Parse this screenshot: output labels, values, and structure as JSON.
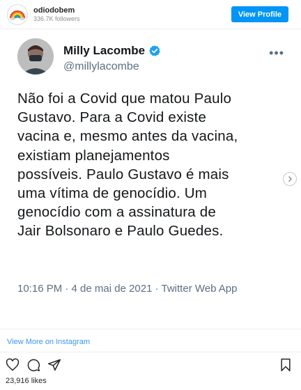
{
  "instagram": {
    "username": "odiodobem",
    "followers": "336.7K followers",
    "view_profile_label": "View Profile",
    "view_more_label": "View More on Instagram",
    "likes": "23,916 likes"
  },
  "tweet": {
    "name": "Milly Lacombe",
    "handle": "@millylacombe",
    "more_glyph": "•••",
    "text": "Não foi a Covid que matou Paulo\nGustavo. Para a Covid existe\nvacina e, mesmo antes da vacina,\nexistiam planejamentos\npossíveis. Paulo Gustavo é mais\numa vítima de genocídio. Um\ngenocídio com a assinatura de\nJair Bolsonaro e Paulo Guedes.",
    "meta": "10:16 PM · 4 de mai de 2021 · Twitter Web App"
  },
  "colors": {
    "ig_blue": "#0095f6",
    "link_blue": "#3897f0",
    "twitter_verified": "#1da1f2",
    "tweet_text": "#14171a",
    "tweet_secondary": "#5b7083"
  },
  "icons": [
    "rainbow-logo-icon",
    "verified-badge-icon",
    "more-dots-icon",
    "next-arrow-icon",
    "heart-icon",
    "comment-icon",
    "share-icon",
    "bookmark-icon"
  ]
}
